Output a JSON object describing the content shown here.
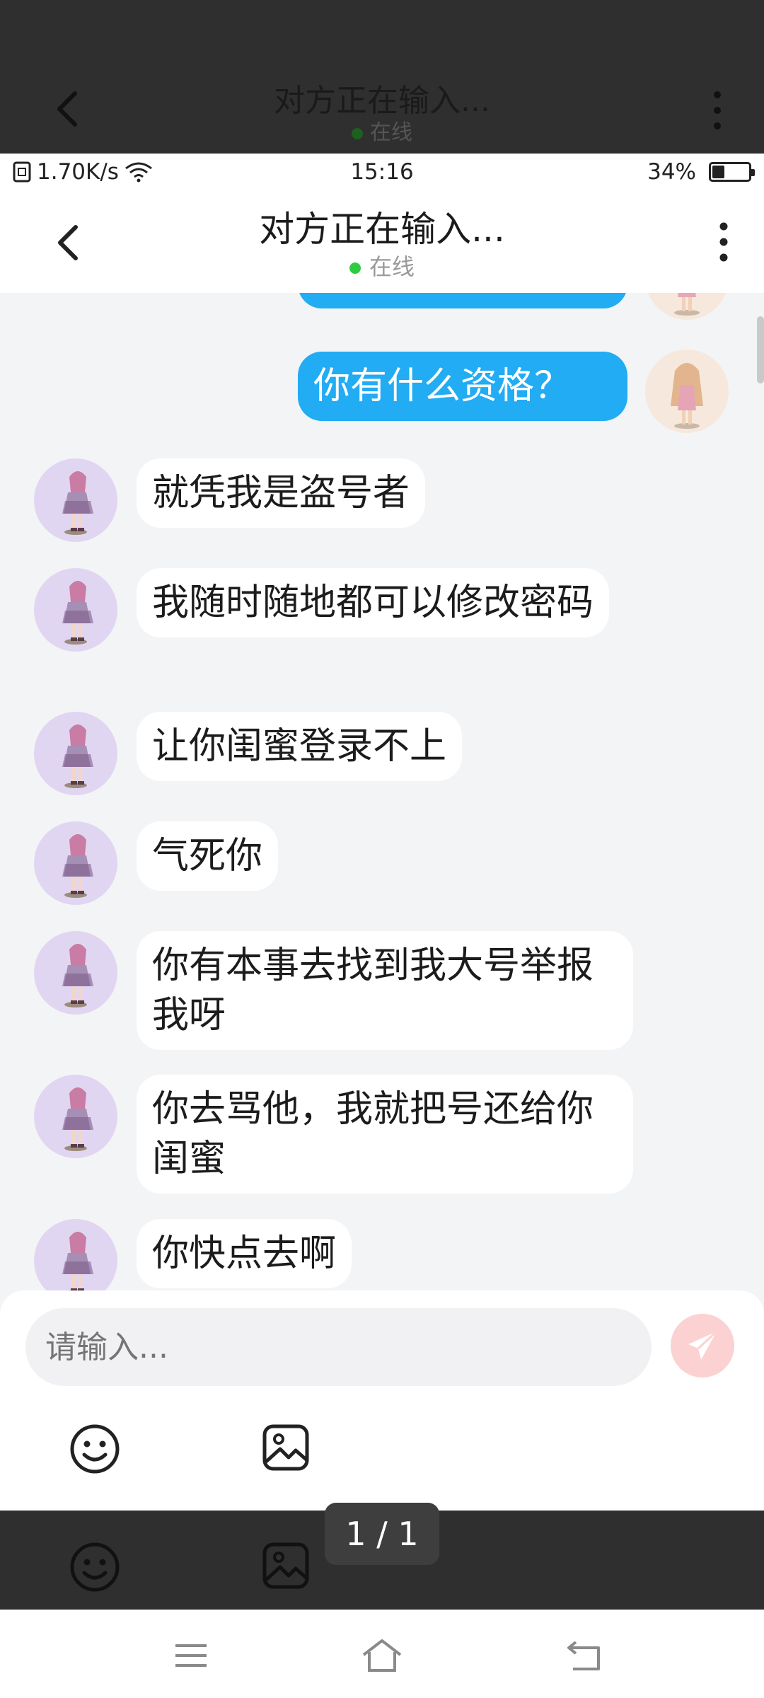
{
  "viewer": {
    "title": "对方正在输入...",
    "status": "在线",
    "page_counter": "1 / 1"
  },
  "statusbar": {
    "network_speed": "1.70K/s",
    "time": "15:16",
    "battery_percent": "34%",
    "battery_level": 0.34
  },
  "header": {
    "title": "对方正在输入...",
    "status": "在线",
    "online_color": "#2ecc40"
  },
  "messages": [
    {
      "side": "right",
      "text": "你有什么资格？"
    },
    {
      "side": "left",
      "text": "就凭我是盗号者"
    },
    {
      "side": "left",
      "text": "我随时随地都可以修改密码"
    },
    {
      "side": "left",
      "text": "让你闺蜜登录不上"
    },
    {
      "side": "left",
      "text": "气死你"
    },
    {
      "side": "left",
      "text": "你有本事去找到我大号举报我呀"
    },
    {
      "side": "left",
      "text": "你去骂他，我就把号还给你闺蜜"
    },
    {
      "side": "left",
      "text": "你快点去啊"
    }
  ],
  "composer": {
    "placeholder": "请输入...",
    "send_color": "#fbd1d1"
  },
  "colors": {
    "my_bubble": "#21acf4",
    "friend_bubble": "#ffffff",
    "background": "#f3f4f6"
  },
  "icons": {
    "back": "chevron-left-icon",
    "more": "more-vertical-icon",
    "send": "send-icon",
    "emoji": "emoji-icon",
    "image": "image-icon",
    "nav_menu": "menu-icon",
    "nav_home": "home-icon",
    "nav_back": "back-icon"
  }
}
